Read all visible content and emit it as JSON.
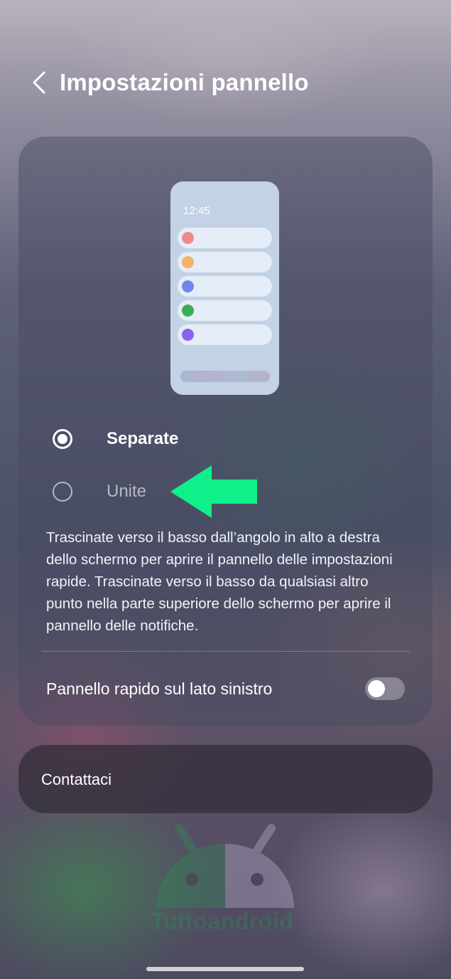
{
  "header": {
    "title": "Impostazioni pannello",
    "back_icon": "chevron-left-icon"
  },
  "preview": {
    "time": "12:45",
    "notification_dot_colors": [
      "#f08a8a",
      "#f5b368",
      "#6f87ea",
      "#3aae57",
      "#8a62ee"
    ]
  },
  "options": {
    "separate_label": "Separate",
    "separate_selected": true,
    "unite_label": "Unite",
    "unite_selected": false
  },
  "annotation": {
    "arrow_color": "#10f08a",
    "icon": "arrow-left-icon"
  },
  "description": "Trascinate verso il basso dall’angolo in alto a destra dello schermo per aprire il pannello delle impostazioni rapide. Trascinate verso il basso da qualsiasi altro punto nella parte superiore dello schermo per aprire il pannello delle notifiche.",
  "quick_panel_left": {
    "label": "Pannello rapido sul lato sinistro",
    "enabled": false
  },
  "contact": {
    "label": "Contattaci"
  },
  "watermark": {
    "text": "Tuttoandroid"
  }
}
